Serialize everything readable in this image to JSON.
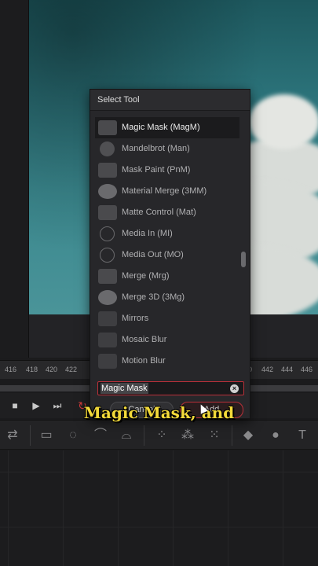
{
  "dialog": {
    "title": "Select Tool",
    "items": [
      {
        "label": "Magic Mask (MagM)",
        "icon": "magic-mask-icon",
        "selected": true
      },
      {
        "label": "Mandelbrot (Man)",
        "icon": "mandelbrot-icon"
      },
      {
        "label": "Mask Paint (PnM)",
        "icon": "mask-paint-icon"
      },
      {
        "label": "Material Merge (3MM)",
        "icon": "material-merge-icon"
      },
      {
        "label": "Matte Control (Mat)",
        "icon": "matte-control-icon"
      },
      {
        "label": "Media In (MI)",
        "icon": "media-in-icon"
      },
      {
        "label": "Media Out (MO)",
        "icon": "media-out-icon"
      },
      {
        "label": "Merge (Mrg)",
        "icon": "merge-icon"
      },
      {
        "label": "Merge 3D (3Mg)",
        "icon": "merge-3d-icon"
      },
      {
        "label": "Mirrors",
        "icon": "mirrors-icon"
      },
      {
        "label": "Mosaic Blur",
        "icon": "mosaic-blur-icon"
      },
      {
        "label": "Motion Blur",
        "icon": "motion-blur-icon"
      }
    ],
    "search_value": "Magic Mask",
    "cancel_label": "Cancel",
    "add_label": "Add"
  },
  "ruler": {
    "left_labels": [
      "416",
      "418",
      "420",
      "422"
    ],
    "right_labels": [
      "0",
      "442",
      "444",
      "446"
    ]
  },
  "caption": "Magic Mask, and",
  "colors": {
    "accent": "#b93039",
    "caption": "#f2d93a",
    "loop_active": "#d23a3a"
  }
}
